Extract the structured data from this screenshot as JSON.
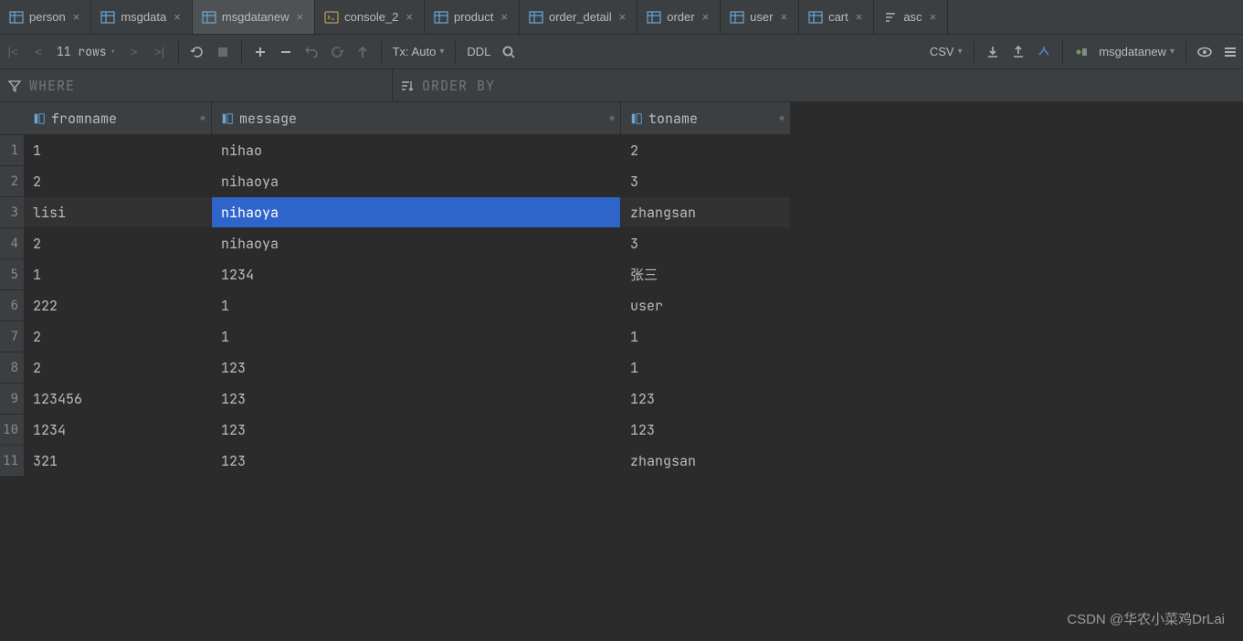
{
  "tabs": [
    {
      "label": "person",
      "icon": "table"
    },
    {
      "label": "msgdata",
      "icon": "table"
    },
    {
      "label": "msgdatanew",
      "icon": "table",
      "active": true
    },
    {
      "label": "console_2",
      "icon": "console"
    },
    {
      "label": "product",
      "icon": "table"
    },
    {
      "label": "order_detail",
      "icon": "table"
    },
    {
      "label": "order",
      "icon": "table"
    },
    {
      "label": "user",
      "icon": "table"
    },
    {
      "label": "cart",
      "icon": "table"
    },
    {
      "label": "asc",
      "icon": "sort"
    }
  ],
  "toolbar": {
    "rows_label": "11 rows",
    "tx_label": "Tx: Auto",
    "ddl_label": "DDL",
    "csv_label": "CSV",
    "context_label": "msgdatanew"
  },
  "filter": {
    "where_ph": "WHERE",
    "orderby_ph": "ORDER BY"
  },
  "columns": [
    {
      "name": "fromname"
    },
    {
      "name": "message"
    },
    {
      "name": "toname"
    }
  ],
  "rows": [
    {
      "n": "1",
      "fromname": "1",
      "message": "nihao",
      "toname": "2"
    },
    {
      "n": "2",
      "fromname": "2",
      "message": "nihaoya",
      "toname": "3"
    },
    {
      "n": "3",
      "fromname": "lisi",
      "message": "nihaoya",
      "toname": "zhangsan",
      "selected": true
    },
    {
      "n": "4",
      "fromname": "2",
      "message": "nihaoya",
      "toname": "3"
    },
    {
      "n": "5",
      "fromname": "1",
      "message": "1234",
      "toname": "张三"
    },
    {
      "n": "6",
      "fromname": "222",
      "message": "1",
      "toname": "user"
    },
    {
      "n": "7",
      "fromname": "2",
      "message": "1",
      "toname": "1"
    },
    {
      "n": "8",
      "fromname": "2",
      "message": "123",
      "toname": "1"
    },
    {
      "n": "9",
      "fromname": "123456",
      "message": "123",
      "toname": "123"
    },
    {
      "n": "10",
      "fromname": "1234",
      "message": "123",
      "toname": "123"
    },
    {
      "n": "11",
      "fromname": "321",
      "message": "123",
      "toname": "zhangsan"
    }
  ],
  "watermark": "CSDN @华农小菜鸡DrLai"
}
